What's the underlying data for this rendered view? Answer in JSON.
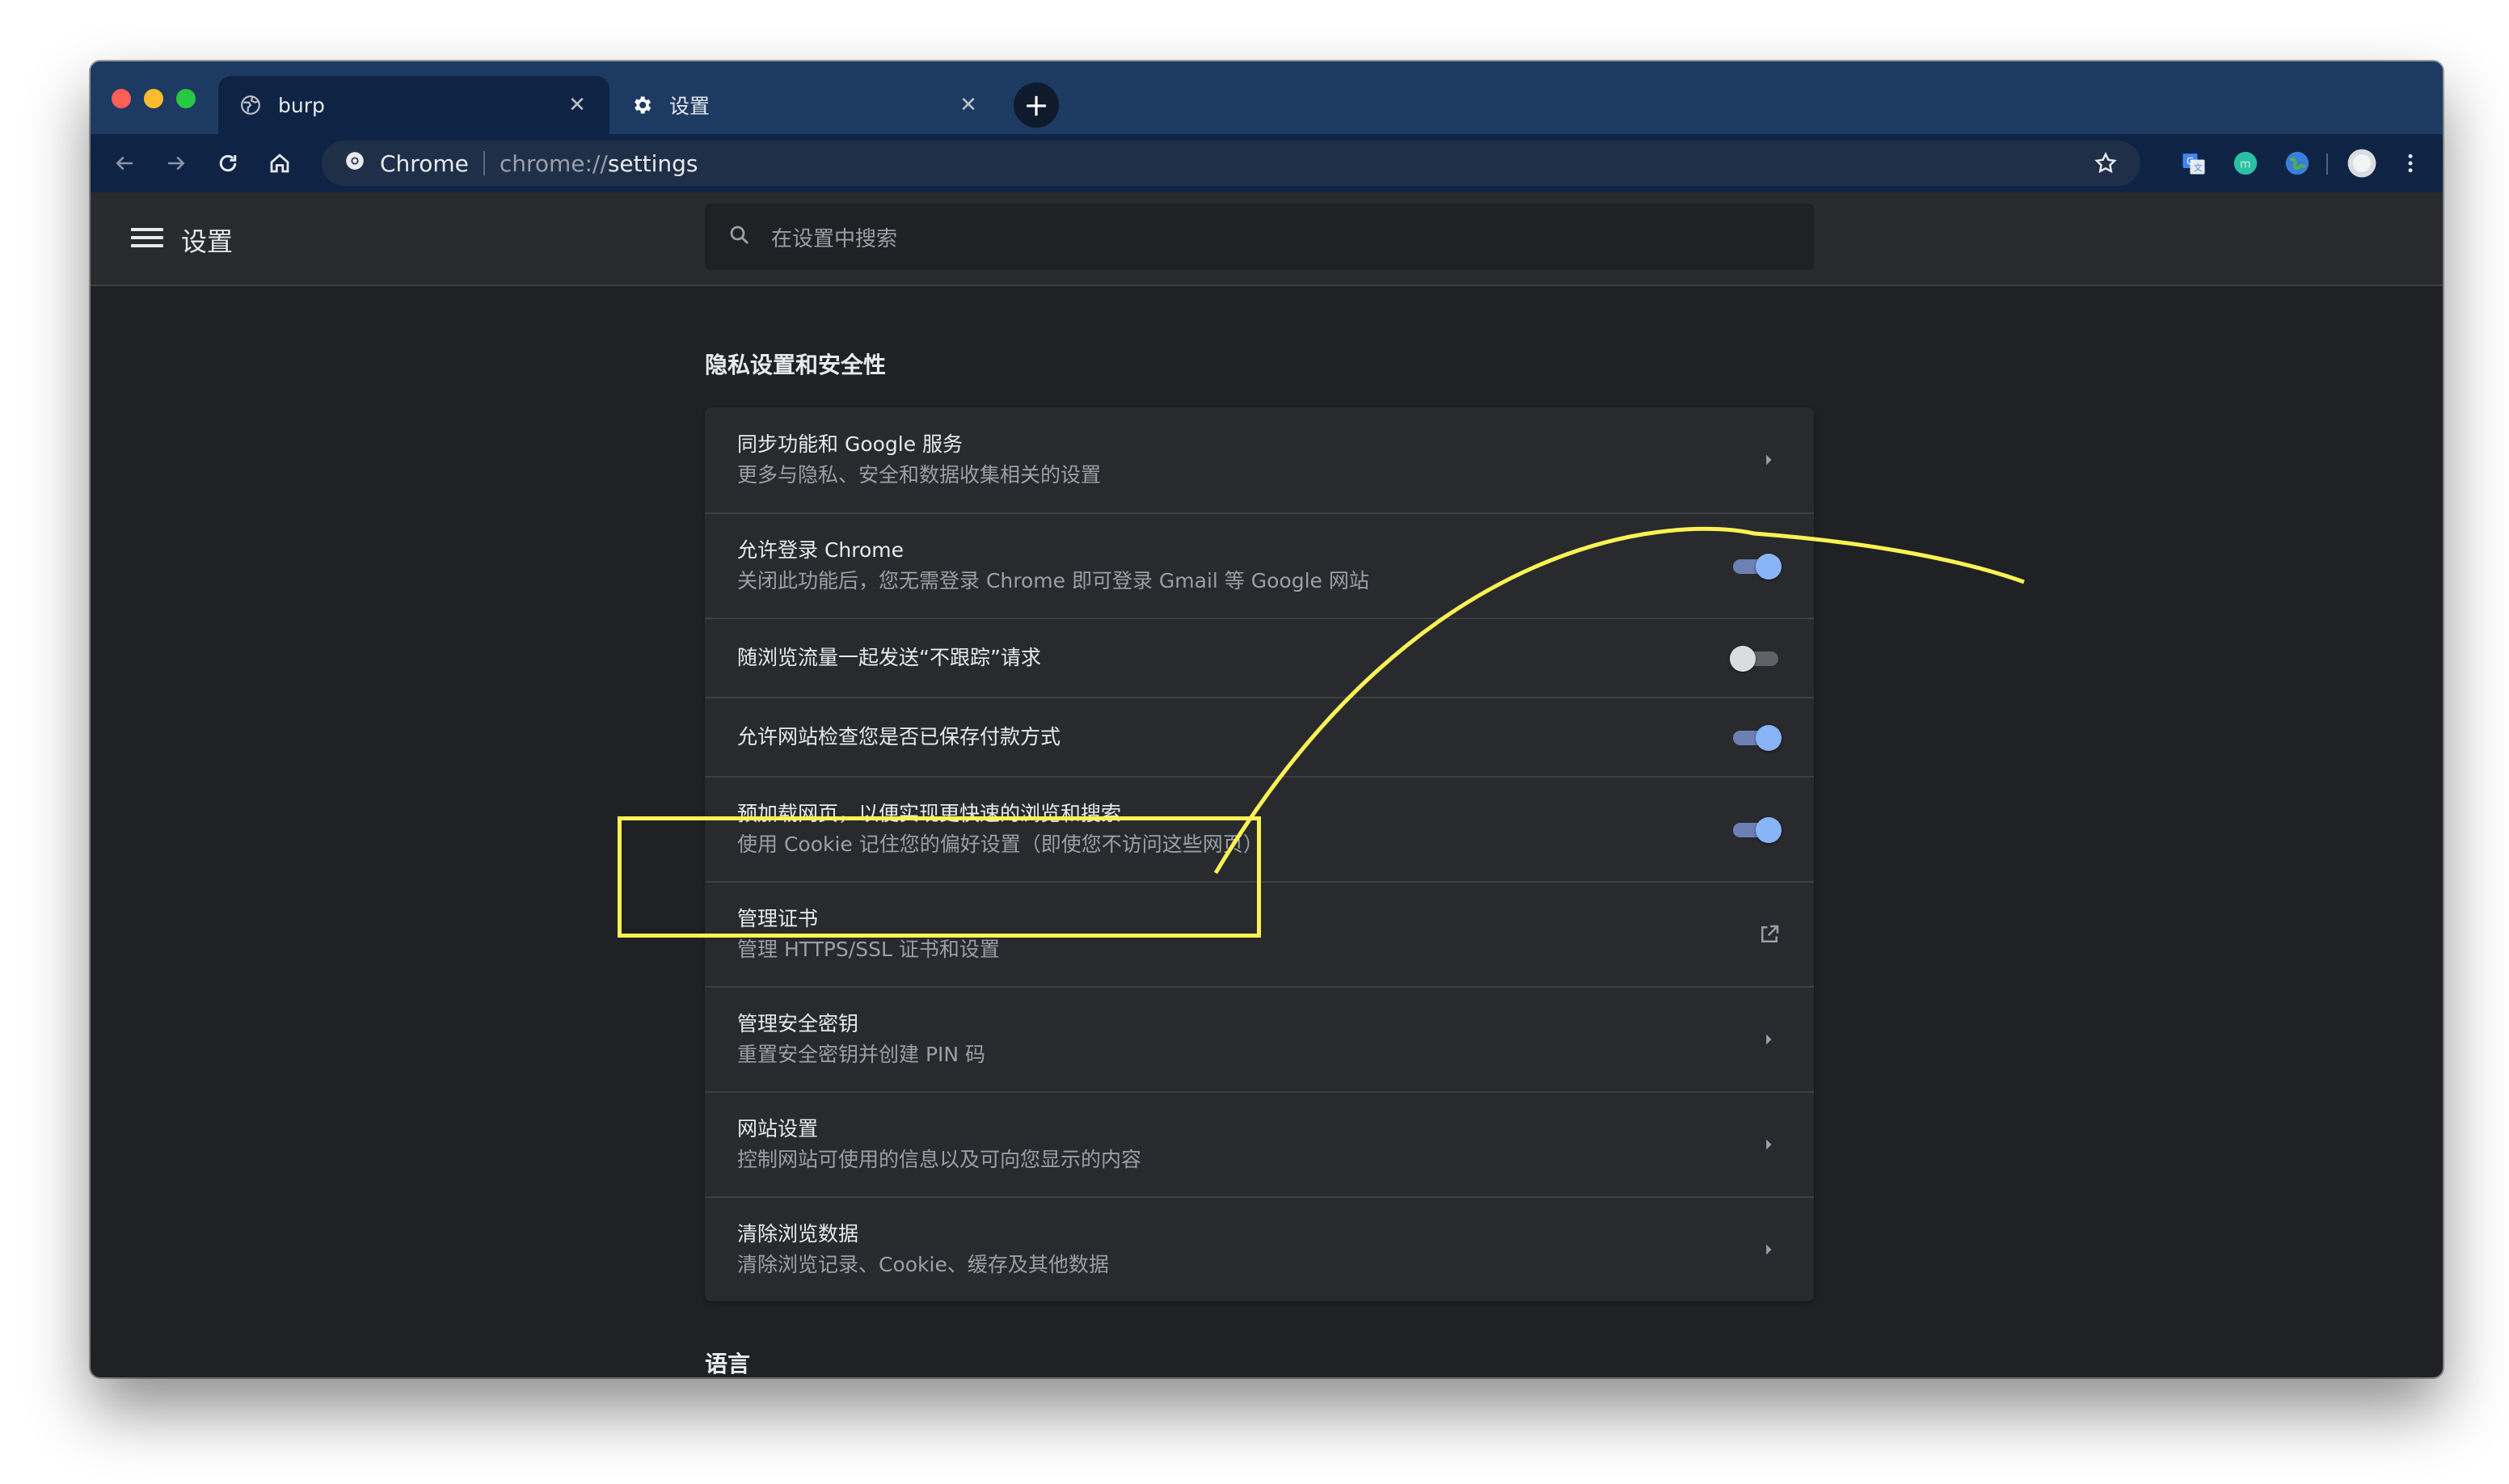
{
  "browser": {
    "tabs": [
      {
        "title": "burp",
        "icon": "globe-icon",
        "active": true
      },
      {
        "title": "设置",
        "icon": "gear-icon",
        "active": false
      }
    ],
    "omnibox": {
      "site_label": "Chrome",
      "url_scheme": "chrome://",
      "url_path": "settings"
    }
  },
  "settings_header": {
    "title": "设置",
    "search_placeholder": "在设置中搜索"
  },
  "privacy_section": {
    "title": "隐私设置和安全性",
    "rows": [
      {
        "primary": "同步功能和 Google 服务",
        "secondary": "更多与隐私、安全和数据收集相关的设置",
        "control": "chevron"
      },
      {
        "primary": "允许登录 Chrome",
        "secondary": "关闭此功能后，您无需登录 Chrome 即可登录 Gmail 等 Google 网站",
        "control": "toggle",
        "on": true
      },
      {
        "primary": "随浏览流量一起发送“不跟踪”请求",
        "control": "toggle",
        "on": false
      },
      {
        "primary": "允许网站检查您是否已保存付款方式",
        "control": "toggle",
        "on": true
      },
      {
        "primary": "预加载网页，以便实现更快速的浏览和搜索",
        "secondary": "使用 Cookie 记住您的偏好设置（即使您不访问这些网页）",
        "control": "toggle",
        "on": true
      },
      {
        "primary": "管理证书",
        "secondary": "管理 HTTPS/SSL 证书和设置",
        "control": "external-link"
      },
      {
        "primary": "管理安全密钥",
        "secondary": "重置安全密钥并创建 PIN 码",
        "control": "chevron"
      },
      {
        "primary": "网站设置",
        "secondary": "控制网站可使用的信息以及可向您显示的内容",
        "control": "chevron"
      },
      {
        "primary": "清除浏览数据",
        "secondary": "清除浏览记录、Cookie、缓存及其他数据",
        "control": "chevron"
      }
    ]
  },
  "next_section": {
    "title": "语言"
  },
  "colors": {
    "annotation": "#fcf253",
    "toggle_on": "#8ab4f8",
    "tab_bar": "#1d3a63",
    "page_bg": "#202124"
  }
}
